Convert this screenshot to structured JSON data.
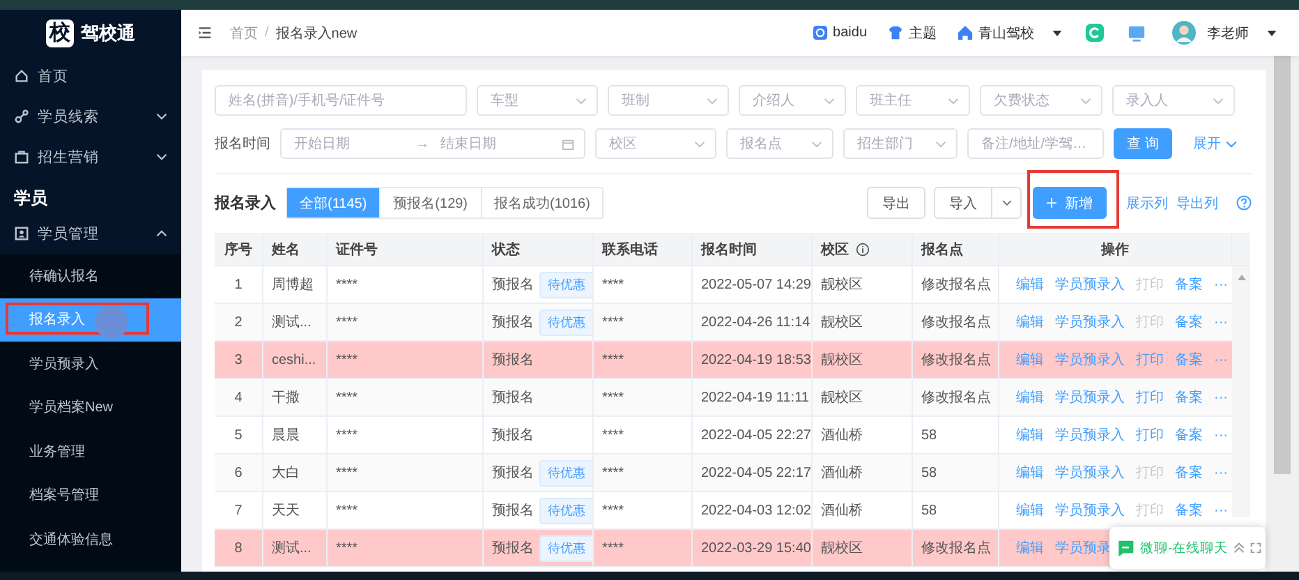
{
  "sidebar": {
    "logo": {
      "mark": "校",
      "name": "驾校通"
    },
    "items": [
      {
        "label": "首页",
        "kind": "link"
      },
      {
        "label": "学员线索",
        "kind": "menu",
        "expanded": false
      },
      {
        "label": "招生营销",
        "kind": "menu",
        "expanded": false
      },
      {
        "label": "学员",
        "kind": "section"
      },
      {
        "label": "学员管理",
        "kind": "menu",
        "expanded": true,
        "children": [
          {
            "label": "待确认报名",
            "selected": false,
            "annotated": false
          },
          {
            "label": "报名录入",
            "selected": true,
            "annotated": true
          },
          {
            "label": "学员预录入",
            "selected": false,
            "annotated": false
          },
          {
            "label": "学员档案New",
            "selected": false,
            "annotated": false
          },
          {
            "label": "业务管理",
            "selected": false,
            "annotated": false
          },
          {
            "label": "档案号管理",
            "selected": false,
            "annotated": false
          },
          {
            "label": "交通体验信息",
            "selected": false,
            "annotated": false
          }
        ]
      }
    ]
  },
  "header": {
    "breadcrumb": [
      "首页",
      "报名录入new"
    ],
    "breadcrumb_separator": "/",
    "links": [
      {
        "label": "baidu",
        "dropdown": false
      },
      {
        "label": "主题",
        "dropdown": false
      },
      {
        "label": "青山驾校",
        "dropdown": true
      }
    ],
    "user": "李老师"
  },
  "filters": {
    "row1": [
      {
        "placeholder": "姓名(拼音)/手机号/证件号",
        "kind": "input"
      },
      {
        "placeholder": "车型",
        "kind": "select"
      },
      {
        "placeholder": "班制",
        "kind": "select"
      },
      {
        "placeholder": "介绍人",
        "kind": "select"
      },
      {
        "placeholder": "班主任",
        "kind": "select"
      },
      {
        "placeholder": "欠费状态",
        "kind": "select"
      },
      {
        "placeholder": "录入人",
        "kind": "select"
      }
    ],
    "date_label": "报名时间",
    "date_start": "开始日期",
    "date_sep": "→",
    "date_end": "结束日期",
    "row2": [
      {
        "placeholder": "校区",
        "kind": "select"
      },
      {
        "placeholder": "报名点",
        "kind": "select"
      },
      {
        "placeholder": "招生部门",
        "kind": "select"
      },
      {
        "placeholder": "备注/地址/学驾…",
        "kind": "input"
      }
    ],
    "search_button": "查 询",
    "expand_link": "展开"
  },
  "toolbar": {
    "title": "报名录入",
    "tabs": [
      {
        "label": "全部(1145)",
        "selected": true
      },
      {
        "label": "预报名(129)",
        "selected": false
      },
      {
        "label": "报名成功(1016)",
        "selected": false
      }
    ],
    "export": "导出",
    "import": "导入",
    "new": {
      "label": "新增",
      "annotated": true
    },
    "show_columns": "展示列",
    "export_columns": "导出列"
  },
  "table": {
    "columns": [
      {
        "label": "序号",
        "info": false
      },
      {
        "label": "姓名",
        "info": false
      },
      {
        "label": "证件号",
        "info": false
      },
      {
        "label": "状态",
        "info": false
      },
      {
        "label": "联系电话",
        "info": false
      },
      {
        "label": "报名时间",
        "info": false
      },
      {
        "label": "校区",
        "info": true
      },
      {
        "label": "报名点",
        "info": false
      },
      {
        "label": "操作",
        "info": false
      }
    ],
    "rows": [
      {
        "no": "1",
        "name": "周博超",
        "id": "****",
        "status": "预报名",
        "tag": "待优惠",
        "phone": "****",
        "time": "2022-05-07 14:29",
        "campus": "靓校区",
        "point": "修改报名点",
        "highlighted": false,
        "actions": [
          {
            "label": "编辑",
            "disabled": false
          },
          {
            "label": "学员预录入",
            "disabled": false
          },
          {
            "label": "打印",
            "disabled": true
          },
          {
            "label": "备案",
            "disabled": false
          },
          {
            "label": "···",
            "disabled": false
          }
        ]
      },
      {
        "no": "2",
        "name": "测试...",
        "id": "****",
        "status": "预报名",
        "tag": "待优惠",
        "phone": "****",
        "time": "2022-04-26 11:14",
        "campus": "靓校区",
        "point": "修改报名点",
        "highlighted": false,
        "actions": [
          {
            "label": "编辑",
            "disabled": false
          },
          {
            "label": "学员预录入",
            "disabled": false
          },
          {
            "label": "打印",
            "disabled": true
          },
          {
            "label": "备案",
            "disabled": false
          },
          {
            "label": "···",
            "disabled": false
          }
        ]
      },
      {
        "no": "3",
        "name": "ceshi...",
        "id": "****",
        "status": "预报名",
        "phone": "****",
        "time": "2022-04-19 18:53",
        "campus": "靓校区",
        "point": "修改报名点",
        "highlighted": true,
        "actions": [
          {
            "label": "编辑",
            "disabled": false
          },
          {
            "label": "学员预录入",
            "disabled": false
          },
          {
            "label": "打印",
            "disabled": false
          },
          {
            "label": "备案",
            "disabled": false
          },
          {
            "label": "···",
            "disabled": false
          }
        ]
      },
      {
        "no": "4",
        "name": "干撒",
        "id": "****",
        "status": "预报名",
        "phone": "****",
        "time": "2022-04-19 11:11",
        "campus": "靓校区",
        "point": "修改报名点",
        "highlighted": false,
        "actions": [
          {
            "label": "编辑",
            "disabled": false
          },
          {
            "label": "学员预录入",
            "disabled": false
          },
          {
            "label": "打印",
            "disabled": false
          },
          {
            "label": "备案",
            "disabled": false
          },
          {
            "label": "···",
            "disabled": false
          }
        ]
      },
      {
        "no": "5",
        "name": "晨晨",
        "id": "****",
        "status": "预报名",
        "phone": "****",
        "time": "2022-04-05 22:27",
        "campus": "酒仙桥",
        "point": "58",
        "highlighted": false,
        "actions": [
          {
            "label": "编辑",
            "disabled": false
          },
          {
            "label": "学员预录入",
            "disabled": false
          },
          {
            "label": "打印",
            "disabled": false
          },
          {
            "label": "备案",
            "disabled": false
          },
          {
            "label": "···",
            "disabled": false
          }
        ]
      },
      {
        "no": "6",
        "name": "大白",
        "id": "****",
        "status": "预报名",
        "tag": "待优惠",
        "phone": "****",
        "time": "2022-04-05 22:17",
        "campus": "酒仙桥",
        "point": "58",
        "highlighted": false,
        "actions": [
          {
            "label": "编辑",
            "disabled": false
          },
          {
            "label": "学员预录入",
            "disabled": false
          },
          {
            "label": "打印",
            "disabled": true
          },
          {
            "label": "备案",
            "disabled": false
          },
          {
            "label": "···",
            "disabled": false
          }
        ]
      },
      {
        "no": "7",
        "name": "天天",
        "id": "****",
        "status": "预报名",
        "tag": "待优惠",
        "phone": "****",
        "time": "2022-04-03 12:02",
        "campus": "酒仙桥",
        "point": "58",
        "highlighted": false,
        "actions": [
          {
            "label": "编辑",
            "disabled": false
          },
          {
            "label": "学员预录入",
            "disabled": false
          },
          {
            "label": "打印",
            "disabled": true
          },
          {
            "label": "备案",
            "disabled": false
          },
          {
            "label": "···",
            "disabled": false
          }
        ]
      },
      {
        "no": "8",
        "name": "测试...",
        "id": "****",
        "status": "预报名",
        "tag": "待优惠",
        "phone": "****",
        "time": "2022-03-29 15:40",
        "campus": "靓校区",
        "point": "修改报名点",
        "highlighted": true,
        "actions": [
          {
            "label": "编辑",
            "disabled": false
          },
          {
            "label": "学员预录",
            "disabled": false
          }
        ]
      }
    ]
  },
  "chat_widget": {
    "label": "微聊-在线聊天"
  }
}
